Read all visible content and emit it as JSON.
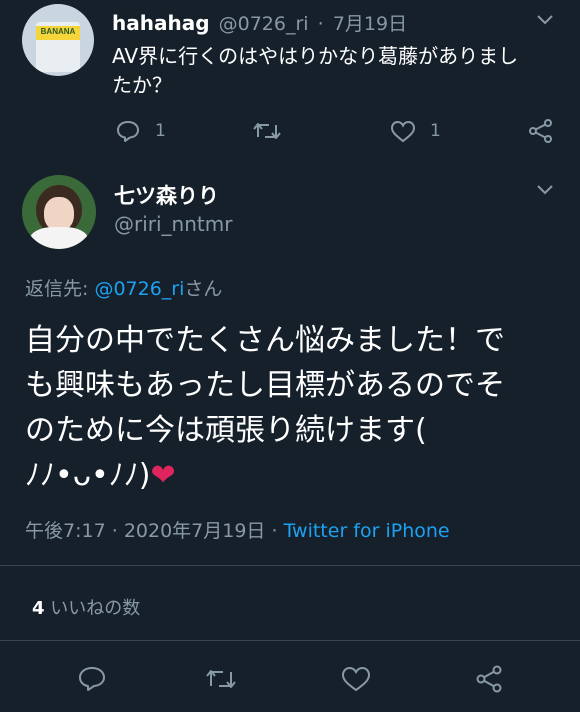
{
  "reply_tweet": {
    "display_name": "hahahag",
    "handle": "@0726_ri",
    "date_sep": "·",
    "date": "7月19日",
    "text_line1": "AV界に行くのはやはりかなり葛藤がありまし",
    "text_line2": "たか？",
    "reply_count": "1",
    "like_count": "1",
    "avatar_label": "BANANA"
  },
  "main_tweet": {
    "display_name": "七ツ森りり",
    "handle": "@riri_nntmr",
    "replying_prefix": "返信先: ",
    "replying_handle": "@0726_ri",
    "replying_suffix": "さん",
    "text_line1": "自分の中でたくさん悩みました！で",
    "text_line2": "も興味もあったし目標があるのでそ",
    "text_line3": "のために今は頑張り続けます(",
    "text_line4": "ﾉﾉ•ᴗ•ﾉﾉ)",
    "heart_emoji": "❤",
    "time": "午後7:17",
    "sep1": "·",
    "full_date": "2020年7月19日",
    "sep2": "·",
    "client": "Twitter for iPhone",
    "likes_count": "4",
    "likes_label": "いいねの数"
  },
  "colors": {
    "background": "#15202b",
    "muted": "#8899a6",
    "link": "#1da1f2",
    "heart": "#e0245e"
  }
}
